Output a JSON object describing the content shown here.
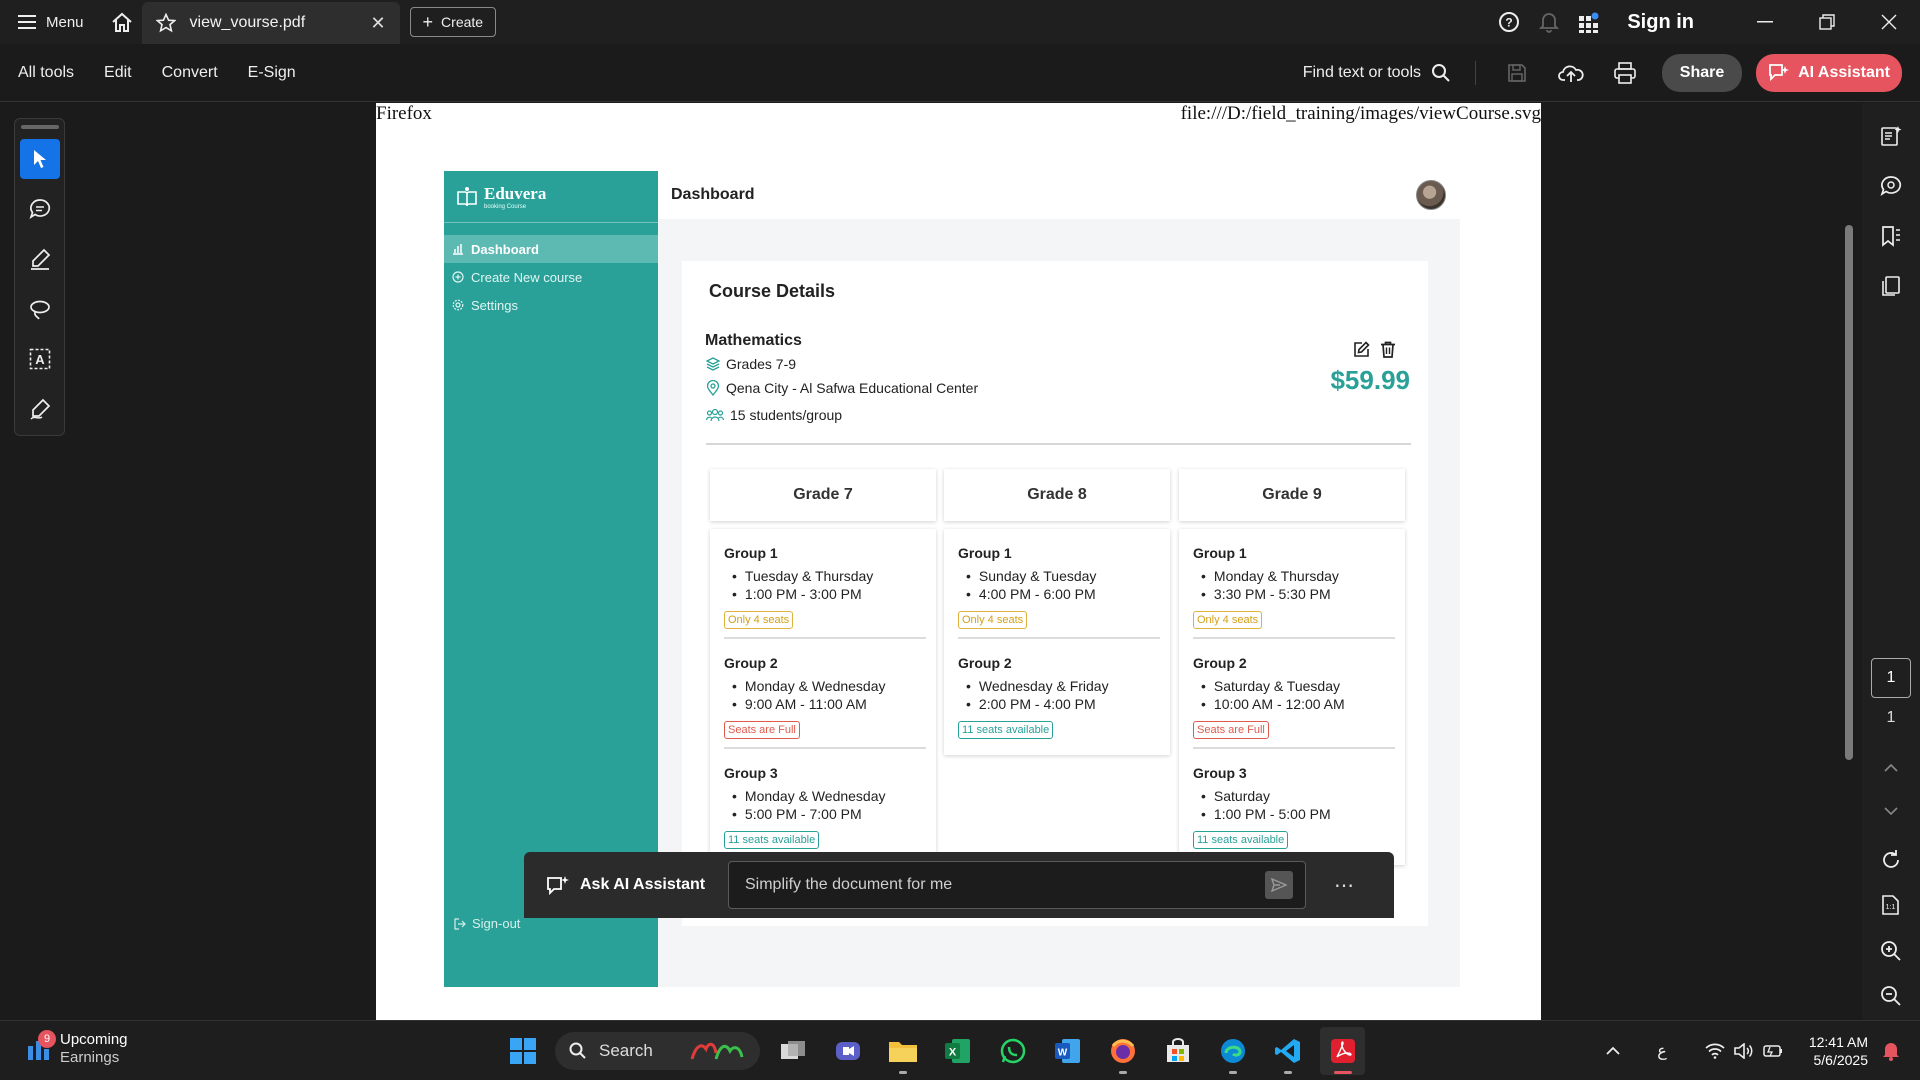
{
  "topbar": {
    "menu_label": "Menu",
    "tab_title": "view_vourse.pdf",
    "create_label": "Create",
    "signin_label": "Sign in"
  },
  "toolbar": {
    "items": [
      "All tools",
      "Edit",
      "Convert",
      "E-Sign"
    ],
    "find_label": "Find text or tools",
    "share_label": "Share",
    "ai_assistant_label": "AI Assistant"
  },
  "pdf_page": {
    "header_left": "Firefox",
    "header_right": "file:///D:/field_training/images/viewCourse.svg"
  },
  "app": {
    "logo_name": "Eduvera",
    "logo_sub": "booking Course",
    "nav": [
      "Dashboard",
      "Create New course",
      "Settings"
    ],
    "signout_label": "Sign-out",
    "page_title": "Dashboard"
  },
  "course": {
    "section_title": "Course Details",
    "subject": "Mathematics",
    "grades": "Grades 7-9",
    "location": "Qena City - Al Safwa Educational Center",
    "capacity": "15 students/group",
    "price": "$59.99",
    "grade_columns": [
      {
        "grade": "Grade 7",
        "groups": [
          {
            "name": "Group 1",
            "days": "Tuesday & Thursday",
            "time": "1:00 PM - 3:00 PM",
            "seats": "Only 4 seats",
            "status": "limited"
          },
          {
            "name": "Group 2",
            "days": "Monday & Wednesday",
            "time": "9:00 AM - 11:00 AM",
            "seats": "Seats are Full",
            "status": "full"
          },
          {
            "name": "Group 3",
            "days": "Monday & Wednesday",
            "time": "5:00 PM - 7:00 PM",
            "seats": "11 seats available",
            "status": "available"
          }
        ]
      },
      {
        "grade": "Grade 8",
        "groups": [
          {
            "name": "Group 1",
            "days": "Sunday & Tuesday",
            "time": "4:00 PM - 6:00 PM",
            "seats": "Only 4 seats",
            "status": "limited"
          },
          {
            "name": "Group 2",
            "days": "Wednesday & Friday",
            "time": "2:00 PM - 4:00 PM",
            "seats": "11 seats available",
            "status": "available"
          }
        ]
      },
      {
        "grade": "Grade 9",
        "groups": [
          {
            "name": "Group 1",
            "days": "Monday & Thursday",
            "time": "3:30 PM - 5:30 PM",
            "seats": "Only 4 seats",
            "status": "limited"
          },
          {
            "name": "Group 2",
            "days": "Saturday & Tuesday",
            "time": "10:00 AM - 12:00 AM",
            "seats": "Seats are Full",
            "status": "full"
          },
          {
            "name": "Group 3",
            "days": "Saturday",
            "time": "1:00 PM - 5:00 PM",
            "seats": "11 seats available",
            "status": "available"
          }
        ]
      }
    ]
  },
  "ai_bar": {
    "label": "Ask AI Assistant",
    "placeholder": "Simplify the document for me"
  },
  "page_nav": {
    "current": "1",
    "total": "1"
  },
  "taskbar": {
    "widget_badge": "9",
    "widget_title": "Upcoming",
    "widget_sub": "Earnings",
    "search_label": "Search",
    "lang": "ع",
    "time": "12:41 AM",
    "date": "5/6/2025"
  },
  "colors": {
    "accent_teal": "#2aa198",
    "ai_red": "#e5545f",
    "active_tool_blue": "#1473e6"
  }
}
